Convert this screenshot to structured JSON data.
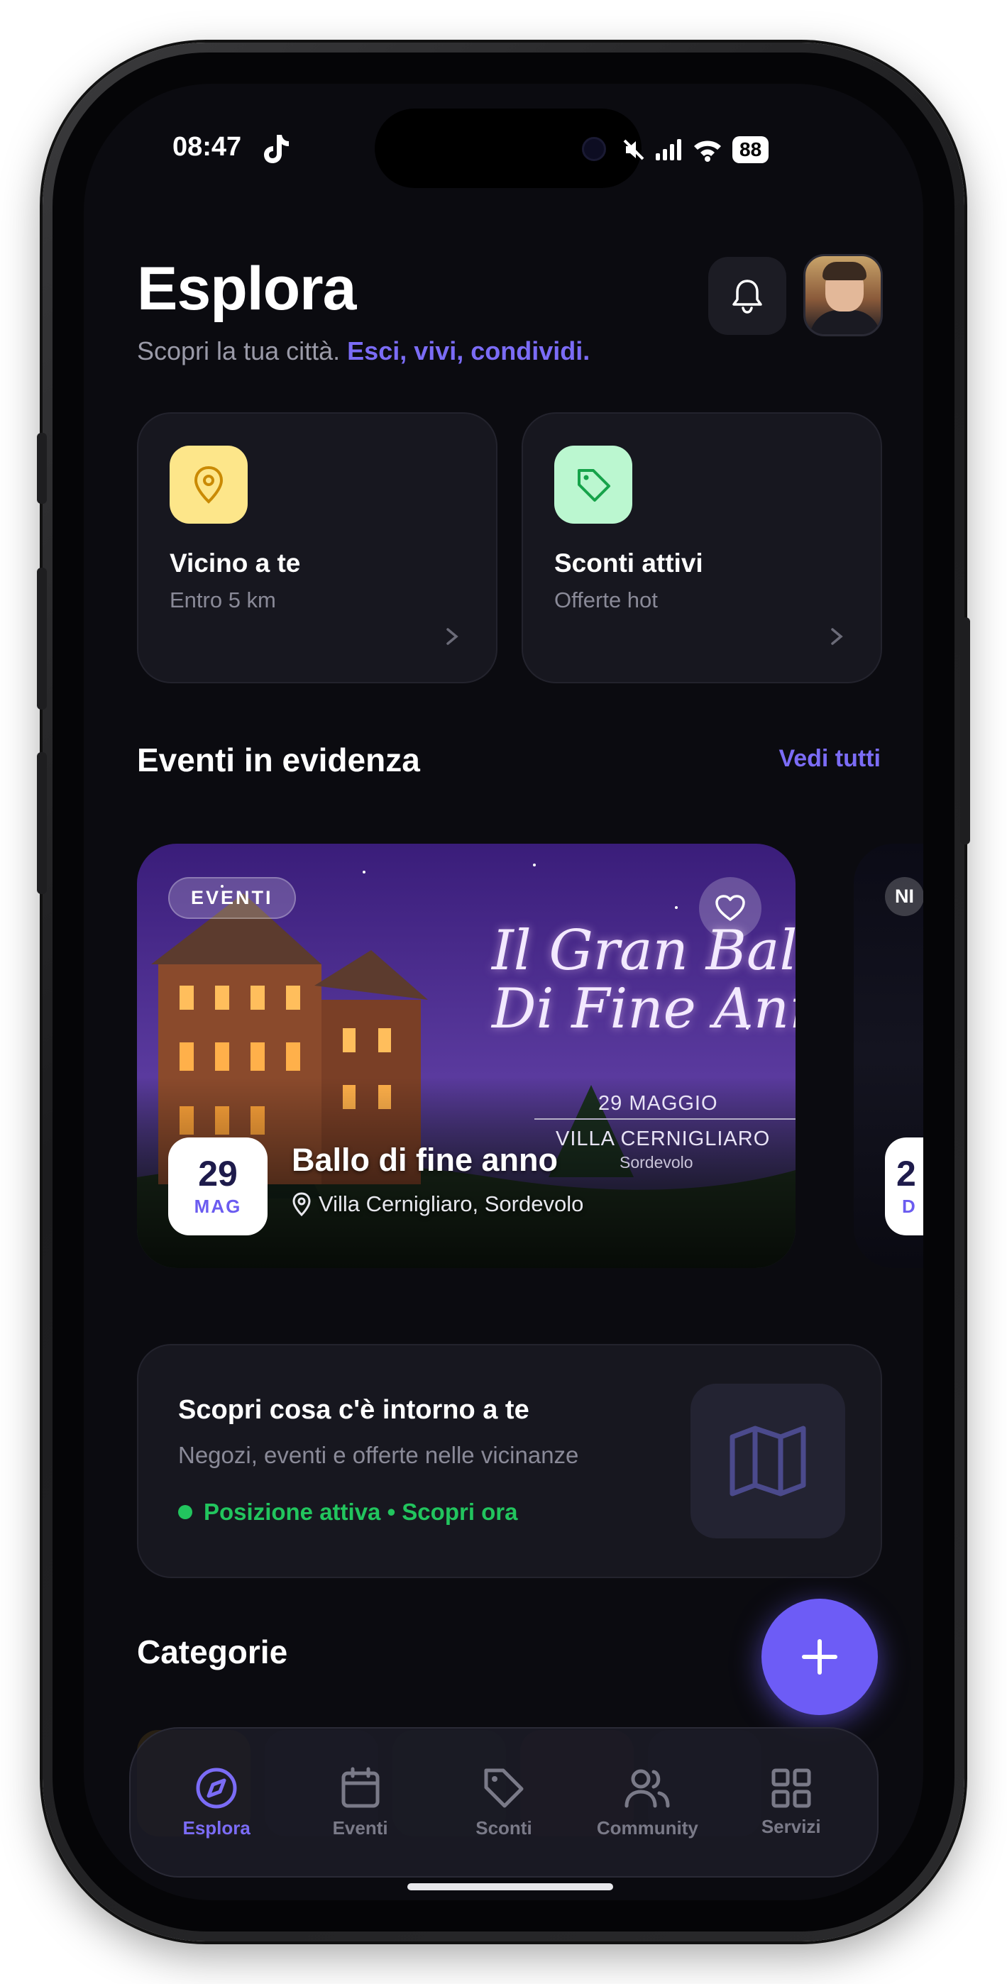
{
  "status": {
    "time": "08:47",
    "battery": "88"
  },
  "header": {
    "title": "Esplora",
    "subtitle_plain": "Scopri la tua città.",
    "subtitle_accent": "Esci, vivi, condividi."
  },
  "quick": [
    {
      "title": "Vicino a te",
      "sub": "Entro 5 km",
      "icon": "location-pin-icon",
      "color": "#fde68a"
    },
    {
      "title": "Sconti attivi",
      "sub": "Offerte hot",
      "icon": "tag-icon",
      "color": "#bbf7d0"
    }
  ],
  "featured": {
    "title": "Eventi in evidenza",
    "see_all": "Vedi tutti",
    "event": {
      "badge": "EVENTI",
      "day": "29",
      "month": "MAG",
      "name": "Ballo di fine anno",
      "location": "Villa Cernigliaro, Sordevolo",
      "poster_title_1": "Il Gran Ballo",
      "poster_title_2": "Di Fine Anno",
      "poster_date": "29 MAGGIO",
      "poster_venue": "VILLA CERNIGLIARO",
      "poster_town": "Sordevolo"
    },
    "next_badge": "NI",
    "next_day": "2",
    "next_month": "D"
  },
  "nearby": {
    "title": "Scopri cosa c'è intorno a te",
    "sub": "Negozi, eventi e offerte nelle vicinanze",
    "status": "Posizione attiva • Scopri ora"
  },
  "categories": {
    "title": "Categorie"
  },
  "tabs": [
    {
      "label": "Esplora",
      "icon": "compass-icon",
      "active": true
    },
    {
      "label": "Eventi",
      "icon": "calendar-icon",
      "active": false
    },
    {
      "label": "Sconti",
      "icon": "tag-icon",
      "active": false
    },
    {
      "label": "Community",
      "icon": "users-icon",
      "active": false
    },
    {
      "label": "Servizi",
      "icon": "grid-icon",
      "active": false
    }
  ],
  "colors": {
    "accent": "#6d5cf6",
    "success": "#22c55e",
    "background": "#0b0b10"
  }
}
